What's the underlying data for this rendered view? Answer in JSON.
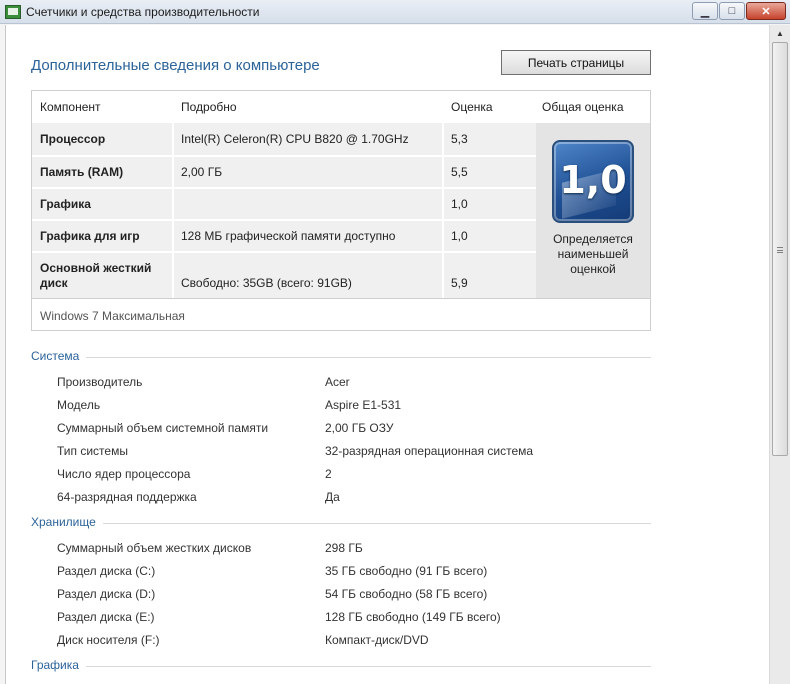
{
  "window": {
    "title": "Счетчики и средства производительности",
    "minimize": "▁",
    "maximize": "□",
    "close": "✕"
  },
  "header": {
    "title": "Дополнительные сведения о компьютере",
    "print_button": "Печать страницы"
  },
  "rating": {
    "columns": {
      "component": "Компонент",
      "detail": "Подробно",
      "score": "Оценка",
      "overall": "Общая оценка"
    },
    "rows": [
      {
        "component": "Процессор",
        "detail": "Intel(R) Celeron(R) CPU B820 @ 1.70GHz",
        "score": "5,3"
      },
      {
        "component": "Память (RAM)",
        "detail": "2,00 ГБ",
        "score": "5,5"
      },
      {
        "component": "Графика",
        "detail": "",
        "score": "1,0"
      },
      {
        "component": "Графика для игр",
        "detail": "128 МБ графической памяти доступно",
        "score": "1,0"
      },
      {
        "component": "Основной жесткий диск",
        "detail": "Свободно: 35GB (всего: 91GB)",
        "score": "5,9"
      }
    ],
    "overall_score": "1,0",
    "overall_note": "Определяется наименьшей оценкой",
    "os": "Windows 7 Максимальная"
  },
  "system": {
    "title": "Система",
    "items": [
      {
        "key": "Производитель",
        "value": "Acer"
      },
      {
        "key": "Модель",
        "value": "Aspire E1-531"
      },
      {
        "key": "Суммарный объем системной памяти",
        "value": "2,00 ГБ ОЗУ"
      },
      {
        "key": "Тип системы",
        "value": "32-разрядная операционная система"
      },
      {
        "key": "Число ядер процессора",
        "value": "2"
      },
      {
        "key": "64-разрядная поддержка",
        "value": "Да"
      }
    ]
  },
  "storage": {
    "title": "Хранилище",
    "items": [
      {
        "key": "Суммарный объем жестких дисков",
        "value": "298 ГБ"
      },
      {
        "key": "Раздел диска (C:)",
        "value": "35 ГБ свободно (91 ГБ всего)"
      },
      {
        "key": "Раздел диска (D:)",
        "value": "54 ГБ свободно (58 ГБ всего)"
      },
      {
        "key": "Раздел диска (E:)",
        "value": "128 ГБ свободно (149 ГБ всего)"
      },
      {
        "key": "Диск носителя (F:)",
        "value": "Компакт-диск/DVD"
      }
    ]
  },
  "graphics": {
    "title": "Графика"
  },
  "scrollbar": {
    "up_arrow": "▲"
  }
}
